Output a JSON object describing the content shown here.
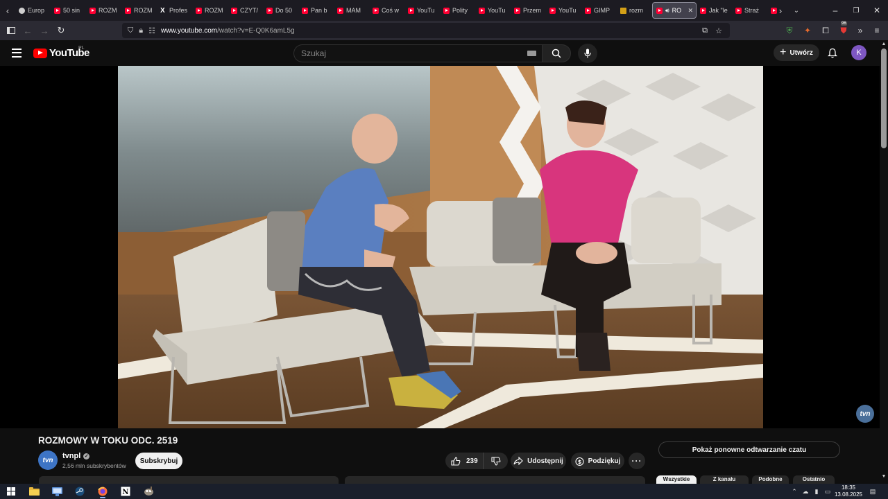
{
  "browser": {
    "tabs": [
      {
        "label": "Europ",
        "icon": "circle-globe-icon"
      },
      {
        "label": "50 sin",
        "icon": "youtube-icon"
      },
      {
        "label": "ROZM",
        "icon": "youtube-icon"
      },
      {
        "label": "ROZM",
        "icon": "youtube-icon"
      },
      {
        "label": "Profes",
        "icon": "x-icon"
      },
      {
        "label": "ROZM",
        "icon": "youtube-icon"
      },
      {
        "label": "CZYT/",
        "icon": "youtube-icon"
      },
      {
        "label": "Do 50",
        "icon": "youtube-icon"
      },
      {
        "label": "Pan b",
        "icon": "youtube-icon"
      },
      {
        "label": "MAM",
        "icon": "youtube-icon"
      },
      {
        "label": "Coś w",
        "icon": "youtube-icon"
      },
      {
        "label": "YouTu",
        "icon": "youtube-icon"
      },
      {
        "label": "Polity",
        "icon": "youtube-icon"
      },
      {
        "label": "YouTu",
        "icon": "youtube-icon"
      },
      {
        "label": "Przem",
        "icon": "youtube-icon"
      },
      {
        "label": "YouTu",
        "icon": "youtube-icon"
      },
      {
        "label": "GIMP",
        "icon": "youtube-icon"
      },
      {
        "label": "rozm",
        "icon": "jp-icon"
      },
      {
        "label": "RO",
        "icon": "youtube-icon",
        "active": true
      },
      {
        "label": "Jak \"le",
        "icon": "youtube-icon"
      },
      {
        "label": "Straż",
        "icon": "youtube-icon"
      },
      {
        "label": "",
        "icon": "youtube-icon"
      }
    ],
    "url_host": "www.youtube.com",
    "url_path": "/watch?v=E-Q0K6amL5g",
    "extension_badge": "96"
  },
  "youtube": {
    "logo_text": "YouTube",
    "region": "PL",
    "search_placeholder": "Szukaj",
    "create_label": "Utwórz",
    "avatar_letter": "K",
    "video_title": "ROZMOWY W TOKU ODC. 2519",
    "channel_name": "tvnpl",
    "channel_logo": "tvn",
    "subscribers": "2,56 mln subskrybentów",
    "subscribe_label": "Subskrybuj",
    "like_count": "239",
    "share_label": "Udostępnij",
    "thanks_label": "Podziękuj",
    "chat_replay_label": "Pokaż ponowne odtwarzanie czatu",
    "watermark": "tvn",
    "chips": [
      "Wszystkie",
      "Z kanału",
      "Podobne",
      "Ostatnio"
    ]
  },
  "taskbar": {
    "time": "18:35",
    "date": "13.08.2025"
  },
  "colors": {
    "youtube_red": "#ff0000",
    "background": "#0f0f0f",
    "accent_avatar": "#7e57c2"
  }
}
